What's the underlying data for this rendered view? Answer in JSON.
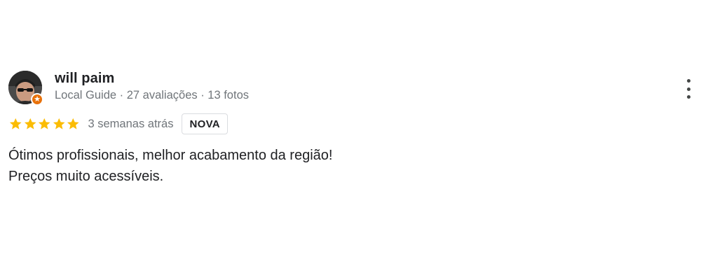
{
  "review": {
    "author_name": "will paim",
    "author_meta": "Local Guide · 27 avaliações · 13 fotos",
    "rating": 5,
    "rating_max": 5,
    "time_ago": "3 semanas atrás",
    "new_badge": "NOVA",
    "text_lines": [
      "Ótimos profissionais, melhor acabamento da região!",
      "Preços muito acessíveis."
    ],
    "avatar_badge_icon": "local-guide-star-icon",
    "more_icon": "more-vert-icon"
  },
  "colors": {
    "star": "#fbbc04",
    "secondary_text": "#70757a",
    "primary_text": "#202124",
    "guide_badge": "#e8710a",
    "badge_border": "#dadce0"
  }
}
